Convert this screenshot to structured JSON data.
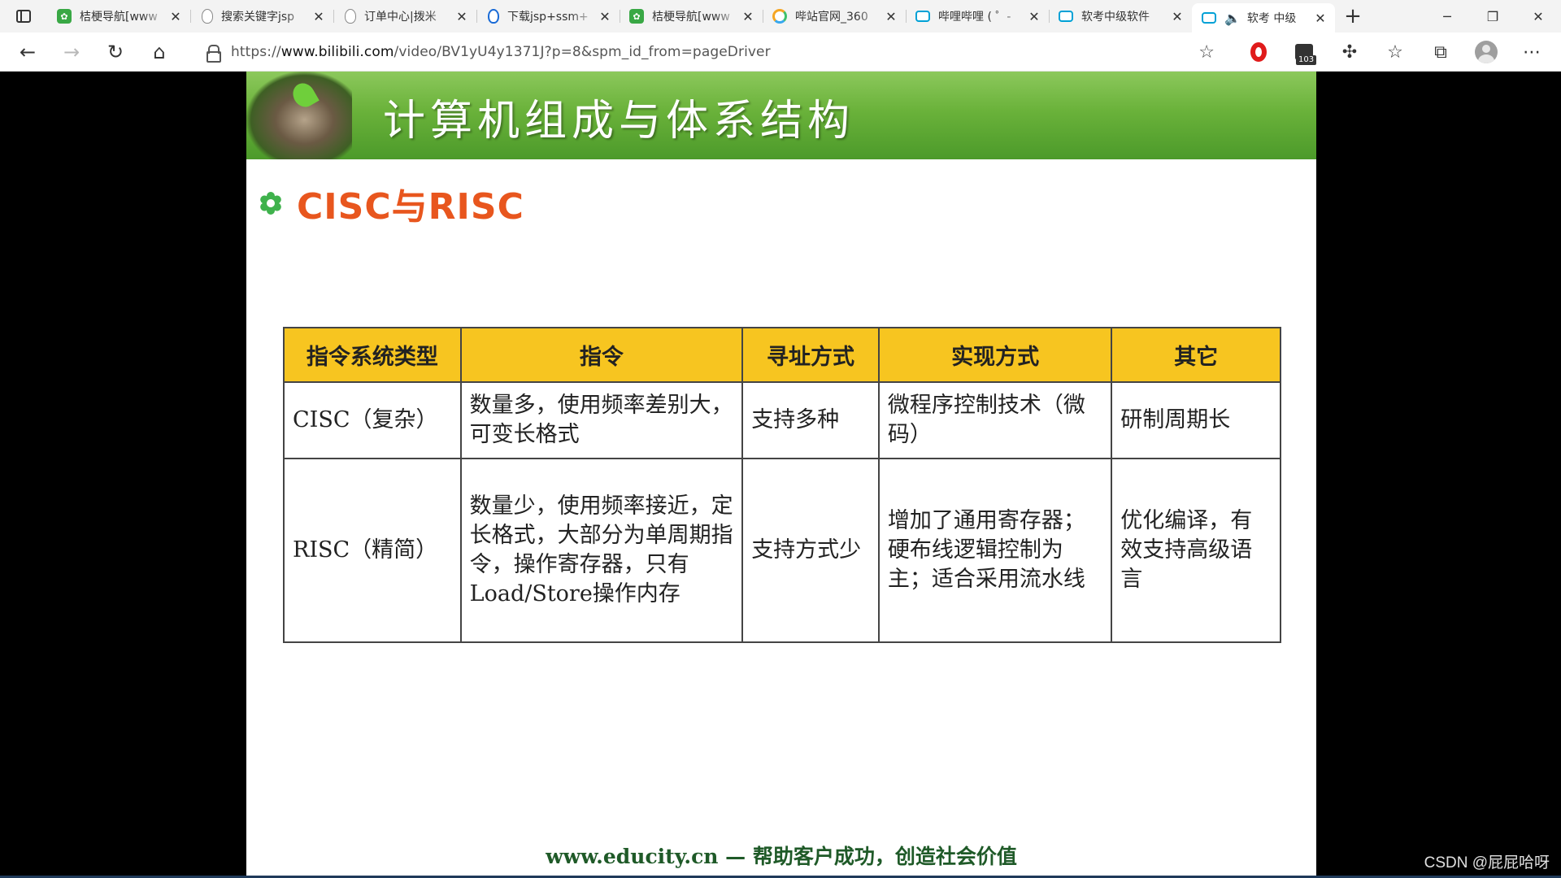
{
  "tabs": [
    {
      "title": "桔梗导航[www",
      "icon": "green-leaf-icon",
      "active": false
    },
    {
      "title": "搜索关键字jsp",
      "icon": "mouse-icon",
      "active": false
    },
    {
      "title": "订单中心|拨米",
      "icon": "mouse-icon",
      "active": false
    },
    {
      "title": "下载jsp+ssm+",
      "icon": "mouse-blue-icon",
      "active": false
    },
    {
      "title": "桔梗导航[www",
      "icon": "green-leaf-icon",
      "active": false
    },
    {
      "title": "哔站官网_360",
      "icon": "360-icon",
      "active": false
    },
    {
      "title": "哔哩哔哩 ( ゜-",
      "icon": "bilibili-icon",
      "active": false
    },
    {
      "title": "软考中级软件",
      "icon": "bilibili-icon",
      "active": false
    },
    {
      "title": "软考 中级",
      "icon": "bilibili-icon",
      "active": true
    }
  ],
  "address": {
    "url_prefix": "https://",
    "url_domain": "www.bilibili.com",
    "url_path": "/video/BV1yU4y1371J?p=8&spm_id_from=pageDriver"
  },
  "toolbar": {
    "extension_badge": "103"
  },
  "slide": {
    "banner_title": "计算机组成与体系结构",
    "subheading": "CISC与RISC",
    "table": {
      "headers": [
        "指令系统类型",
        "指令",
        "寻址方式",
        "实现方式",
        "其它"
      ],
      "rows": [
        [
          "CISC（复杂）",
          "数量多，使用频率差别大，可变长格式",
          "支持多种",
          "微程序控制技术（微码）",
          "研制周期长"
        ],
        [
          "RISC（精简）",
          "数量少，使用频率接近，定长格式，大部分为单周期指令，操作寄存器，只有Load/Store操作内存",
          "支持方式少",
          "增加了通用寄存器；硬布线逻辑控制为主；适合采用流水线",
          "优化编译，有效支持高级语言"
        ]
      ]
    },
    "footer": "www.educity.cn — 帮助客户成功，创造社会价值"
  },
  "watermark": "CSDN @屁屁哈呀"
}
